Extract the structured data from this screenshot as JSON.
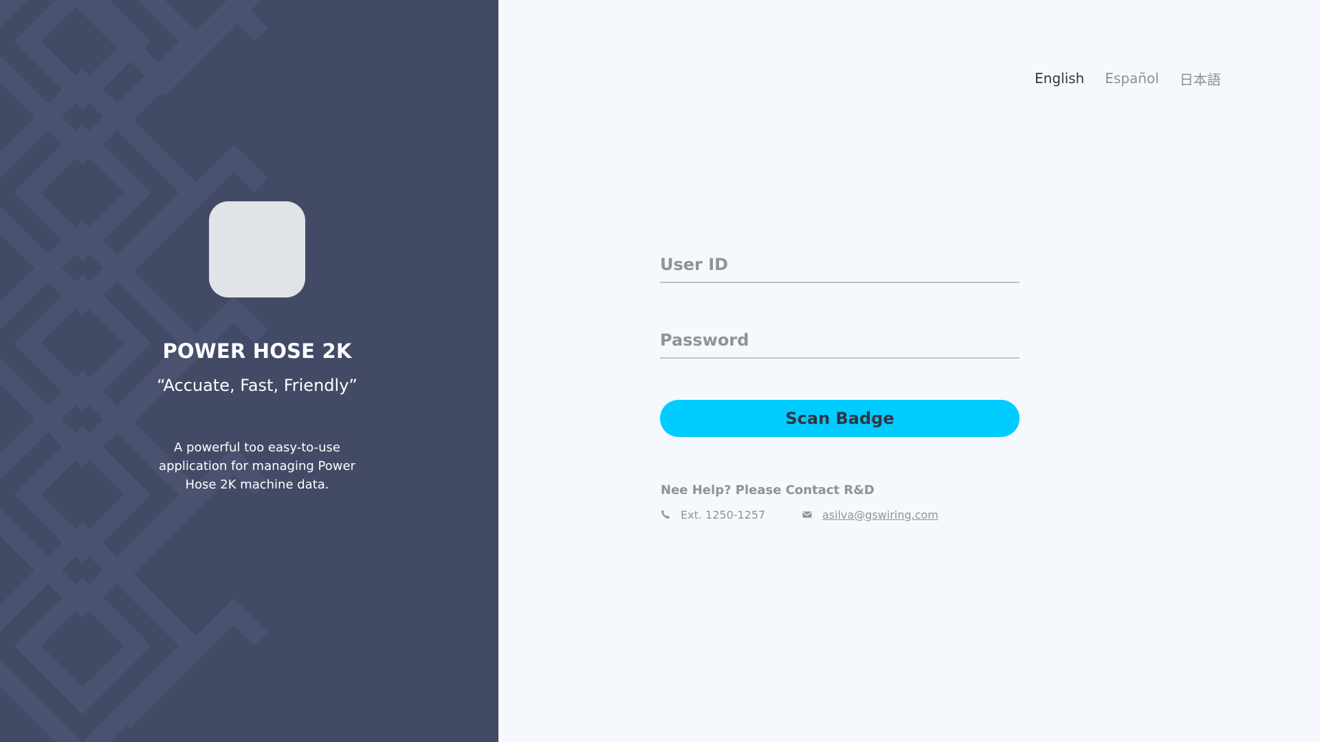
{
  "brand": {
    "title": "POWER HOSE 2K",
    "tagline": "“Accuate, Fast, Friendly”",
    "description": "A powerful too easy-to-use application for managing Power Hose 2K machine data."
  },
  "languages": [
    {
      "label": "English",
      "active": true
    },
    {
      "label": "Español",
      "active": false
    },
    {
      "label": "日本語",
      "active": false
    }
  ],
  "form": {
    "user_id_placeholder": "User ID",
    "password_placeholder": "Password",
    "scan_button": "Scan Badge"
  },
  "help": {
    "title": "Nee Help? Please Contact R&D",
    "phone": "Ext. 1250-1257",
    "email": "asilva@gswiring.com"
  },
  "icons": {
    "phone": "phone-icon",
    "email": "envelope-icon"
  },
  "colors": {
    "sidebar_bg": "#434a66",
    "page_bg": "#f5f9fd",
    "accent": "#00ccff",
    "logo_bg": "#e0e3e8"
  }
}
